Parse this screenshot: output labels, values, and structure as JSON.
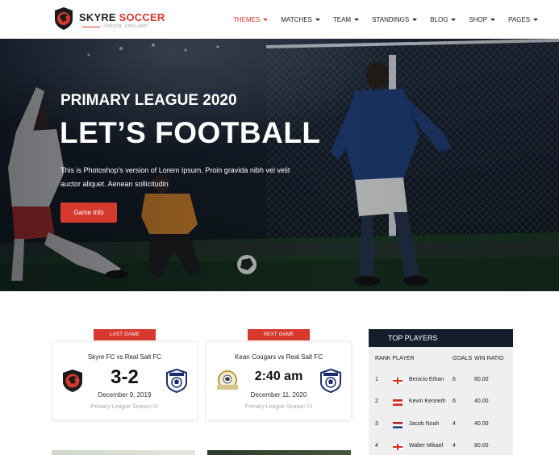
{
  "brand": {
    "name_part1": "SKYRE ",
    "name_part2": "SOCCER",
    "location": "LONDON, ENGLAND",
    "accent_color": "#d63a2f"
  },
  "nav": {
    "items": [
      {
        "label": "THEMES",
        "active": true
      },
      {
        "label": "MATCHES",
        "active": false
      },
      {
        "label": "TEAM",
        "active": false
      },
      {
        "label": "STANDINGS",
        "active": false
      },
      {
        "label": "BLOG",
        "active": false
      },
      {
        "label": "SHOP",
        "active": false
      },
      {
        "label": "PAGES",
        "active": false
      }
    ]
  },
  "hero": {
    "kicker": "PRIMARY LEAGUE 2020",
    "title": "LET’S FOOTBALL",
    "text": "This is Photoshop's version of Lorem Ipsum. Proin gravida nibh vel velit auctor aliquet. Aenean sollicitudin",
    "button_label": "Game Info"
  },
  "last_game": {
    "tag": "LAST GAME",
    "match": "Skyre FC vs Real Salt FC",
    "score": "3-2",
    "date": "December 9, 2019",
    "season": "Primary League Season IV"
  },
  "next_game": {
    "tag": "NEXT GAME",
    "match": "Kean Cougars vs Real Salt FC",
    "time": "2:40 am",
    "date": "December 11, 2020",
    "season": "Primary League Season IV"
  },
  "top_players": {
    "title": "TOP PLAYERS",
    "headers": {
      "rank_player": "RANK PLAYER",
      "goals": "GOALS",
      "ratio": "WIN RATIO"
    },
    "rows": [
      {
        "rank": "1",
        "flag": "england-flag",
        "name": "Benicio Ethan",
        "goals": "6",
        "ratio": "80.00"
      },
      {
        "rank": "2",
        "flag": "austria-flag",
        "name": "Kevin Kenneth",
        "goals": "6",
        "ratio": "40.00"
      },
      {
        "rank": "3",
        "flag": "netherlands-flag",
        "name": "Jacob Noah",
        "goals": "4",
        "ratio": "40.00"
      },
      {
        "rank": "4",
        "flag": "england-flag",
        "name": "Walter Mikael",
        "goals": "4",
        "ratio": "80.00"
      }
    ]
  }
}
